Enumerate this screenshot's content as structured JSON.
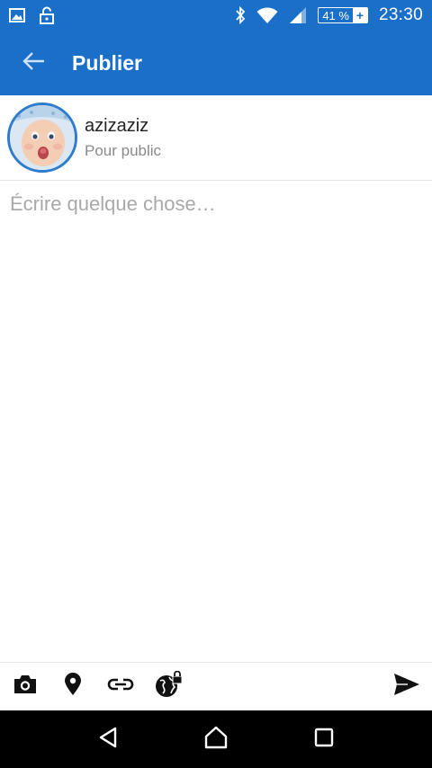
{
  "status_bar": {
    "left_icons": [
      "image-icon",
      "lock-icon"
    ],
    "right_icons": [
      "bluetooth-icon",
      "wifi-icon",
      "signal-icon"
    ],
    "battery_percent": "41 %",
    "battery_symbol": "+",
    "time": "23:30"
  },
  "app_bar": {
    "back_icon": "arrow-left-icon",
    "title": "Publier"
  },
  "author": {
    "name": "azizaziz",
    "audience": "Pour public"
  },
  "compose": {
    "placeholder": "Écrire quelque chose…",
    "value": ""
  },
  "toolbar": {
    "tools": [
      "camera-icon",
      "location-pin-icon",
      "link-icon",
      "globe-lock-icon"
    ],
    "send_icon": "send-icon"
  },
  "nav_bar": {
    "buttons": [
      "back-triangle-icon",
      "home-icon",
      "recents-square-icon"
    ]
  },
  "colors": {
    "primary": "#1a6fc8",
    "avatar_ring": "#2f7ccc",
    "placeholder": "#a9a9a9",
    "secondary_text": "#8a8a8a"
  }
}
